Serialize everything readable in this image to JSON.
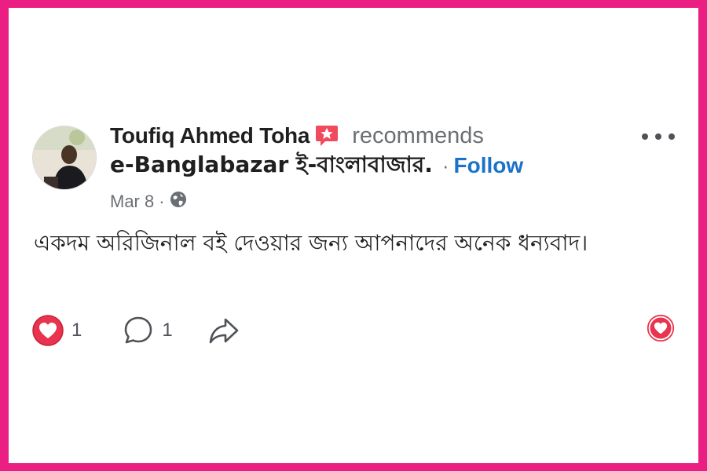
{
  "post": {
    "author": "Toufiq Ahmed Toha",
    "action": "recommends",
    "page_name": "e-Banglabazar ই-বাংলাবাজার.",
    "separator": "·",
    "follow_label": "Follow",
    "date": "Mar 8",
    "meta_separator": "·",
    "audience_icon": "globe-icon",
    "text": "একদম অরিজিনাল বই দেওয়ার জন্য আপনাদের অনেক ধন্যবাদ।",
    "reactions": {
      "love_count": "1",
      "comment_count": "1"
    }
  },
  "colors": {
    "frame": "#ea1e83",
    "follow": "#1a73c9",
    "love": "#e8344f",
    "recommend_badge": "#f04a5f"
  }
}
